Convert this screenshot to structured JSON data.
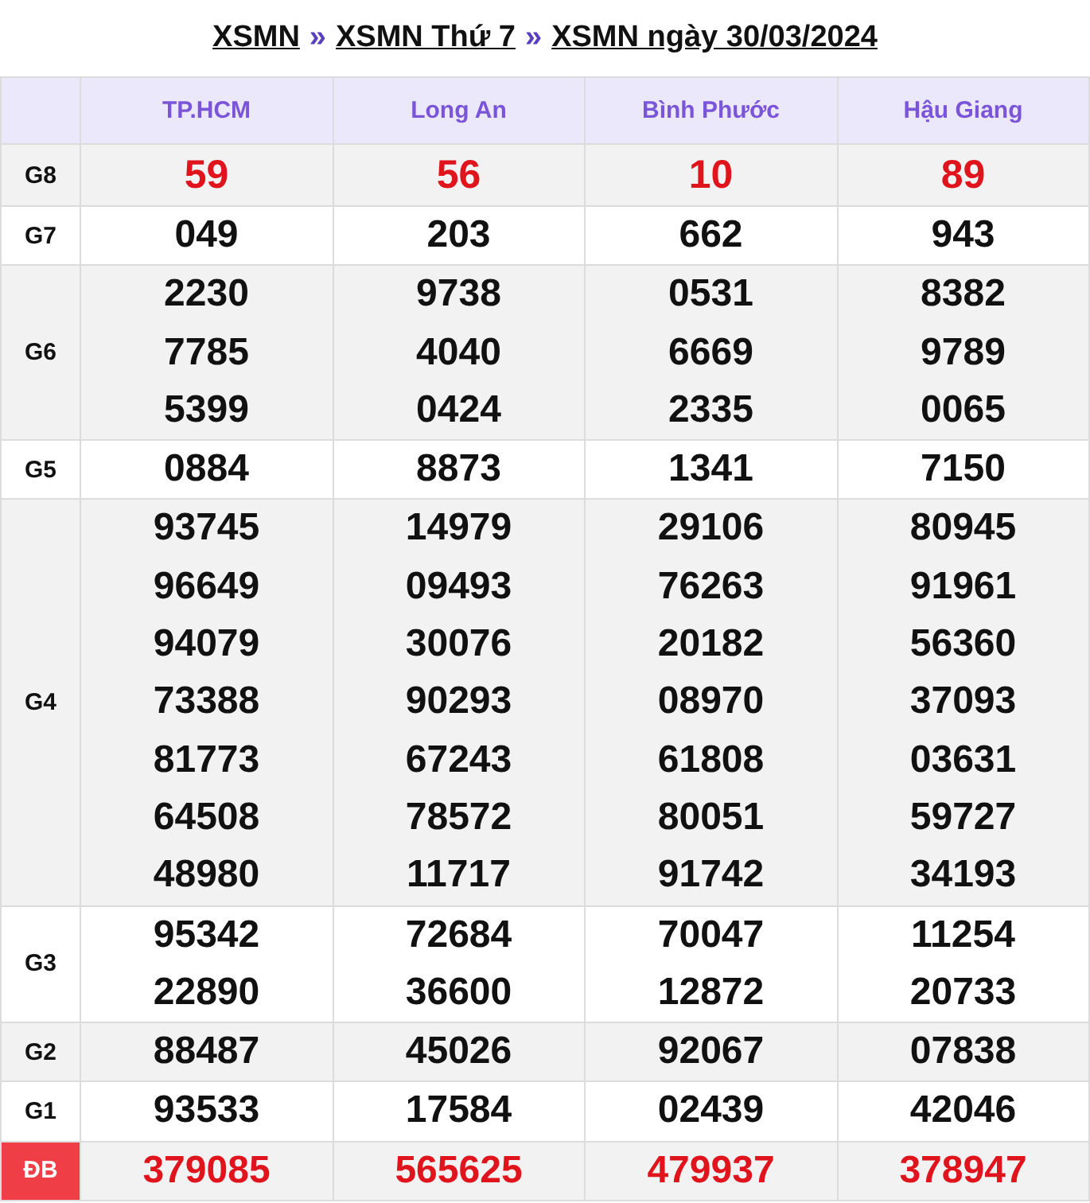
{
  "breadcrumb": {
    "links": [
      "XSMN",
      "XSMN Thứ 7",
      "XSMN ngày 30/03/2024"
    ],
    "separator": "»"
  },
  "table": {
    "columns": [
      "TP.HCM",
      "Long An",
      "Bình Phước",
      "Hậu Giang"
    ],
    "rows": [
      {
        "label": "G8",
        "kind": "top",
        "cells": [
          [
            "59"
          ],
          [
            "56"
          ],
          [
            "10"
          ],
          [
            "89"
          ]
        ]
      },
      {
        "label": "G7",
        "kind": "prize",
        "cells": [
          [
            "049"
          ],
          [
            "203"
          ],
          [
            "662"
          ],
          [
            "943"
          ]
        ]
      },
      {
        "label": "G6",
        "kind": "prize",
        "cells": [
          [
            "2230",
            "7785",
            "5399"
          ],
          [
            "9738",
            "4040",
            "0424"
          ],
          [
            "0531",
            "6669",
            "2335"
          ],
          [
            "8382",
            "9789",
            "0065"
          ]
        ]
      },
      {
        "label": "G5",
        "kind": "prize",
        "cells": [
          [
            "0884"
          ],
          [
            "8873"
          ],
          [
            "1341"
          ],
          [
            "7150"
          ]
        ]
      },
      {
        "label": "G4",
        "kind": "prize",
        "cells": [
          [
            "93745",
            "96649",
            "94079",
            "73388",
            "81773",
            "64508",
            "48980"
          ],
          [
            "14979",
            "09493",
            "30076",
            "90293",
            "67243",
            "78572",
            "11717"
          ],
          [
            "29106",
            "76263",
            "20182",
            "08970",
            "61808",
            "80051",
            "91742"
          ],
          [
            "80945",
            "91961",
            "56360",
            "37093",
            "03631",
            "59727",
            "34193"
          ]
        ]
      },
      {
        "label": "G3",
        "kind": "prize",
        "cells": [
          [
            "95342",
            "22890"
          ],
          [
            "72684",
            "36600"
          ],
          [
            "70047",
            "12872"
          ],
          [
            "11254",
            "20733"
          ]
        ]
      },
      {
        "label": "G2",
        "kind": "prize",
        "cells": [
          [
            "88487"
          ],
          [
            "45026"
          ],
          [
            "92067"
          ],
          [
            "07838"
          ]
        ]
      },
      {
        "label": "G1",
        "kind": "prize",
        "cells": [
          [
            "93533"
          ],
          [
            "17584"
          ],
          [
            "02439"
          ],
          [
            "42046"
          ]
        ]
      },
      {
        "label": "ĐB",
        "kind": "special",
        "cells": [
          [
            "379085"
          ],
          [
            "565625"
          ],
          [
            "479937"
          ],
          [
            "378947"
          ]
        ]
      }
    ]
  }
}
